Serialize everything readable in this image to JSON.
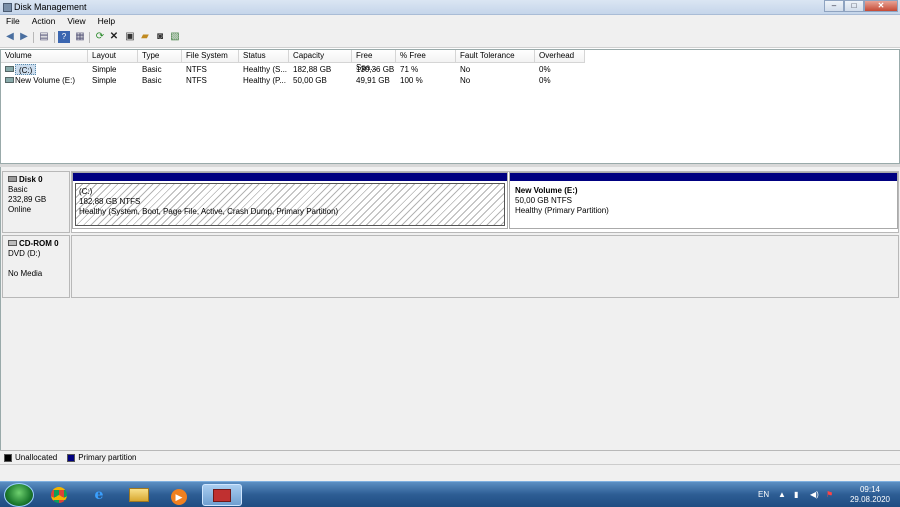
{
  "window": {
    "title": "Disk Management",
    "controls": {
      "minimize": "–",
      "maximize": "□",
      "close": "✕"
    }
  },
  "menu": [
    "File",
    "Action",
    "View",
    "Help"
  ],
  "toolbar": [
    "back-arrow",
    "forward-arrow",
    "show-hide-console-tree",
    "help",
    "properties",
    "refresh",
    "delete",
    "connect",
    "open",
    "rescan",
    "export"
  ],
  "volumes": {
    "columns": [
      "Volume",
      "Layout",
      "Type",
      "File System",
      "Status",
      "Capacity",
      "Free Spa...",
      "% Free",
      "Fault Tolerance",
      "Overhead"
    ],
    "rows": [
      [
        "(C:)",
        "Simple",
        "Basic",
        "NTFS",
        "Healthy (S...",
        "182,88 GB",
        "130,36 GB",
        "71 %",
        "No",
        "0%"
      ],
      [
        "New Volume (E:)",
        "Simple",
        "Basic",
        "NTFS",
        "Healthy (P...",
        "50,00 GB",
        "49,91 GB",
        "100 %",
        "No",
        "0%"
      ]
    ]
  },
  "disks": [
    {
      "name": "Disk 0",
      "type": "Basic",
      "size": "232,89 GB",
      "status": "Online",
      "partitions": [
        {
          "name": "(C:)",
          "size": "182,88 GB NTFS",
          "status": "Healthy (System, Boot, Page File, Active, Crash Dump, Primary Partition)",
          "selected": true
        },
        {
          "name": "New Volume  (E:)",
          "size": "50,00 GB NTFS",
          "status": "Healthy (Primary Partition)",
          "selected": false
        }
      ]
    },
    {
      "name": "CD-ROM 0",
      "type": "DVD (D:)",
      "status": "No Media"
    }
  ],
  "legend": [
    {
      "label": "Unallocated",
      "color": "#000000"
    },
    {
      "label": "Primary partition",
      "color": "#000080"
    }
  ],
  "taskbar": {
    "apps": [
      "chrome",
      "internet-explorer",
      "file-explorer",
      "media-player",
      "disk-management"
    ],
    "language": "EN",
    "time": "09:14",
    "date": "29.08.2020"
  }
}
